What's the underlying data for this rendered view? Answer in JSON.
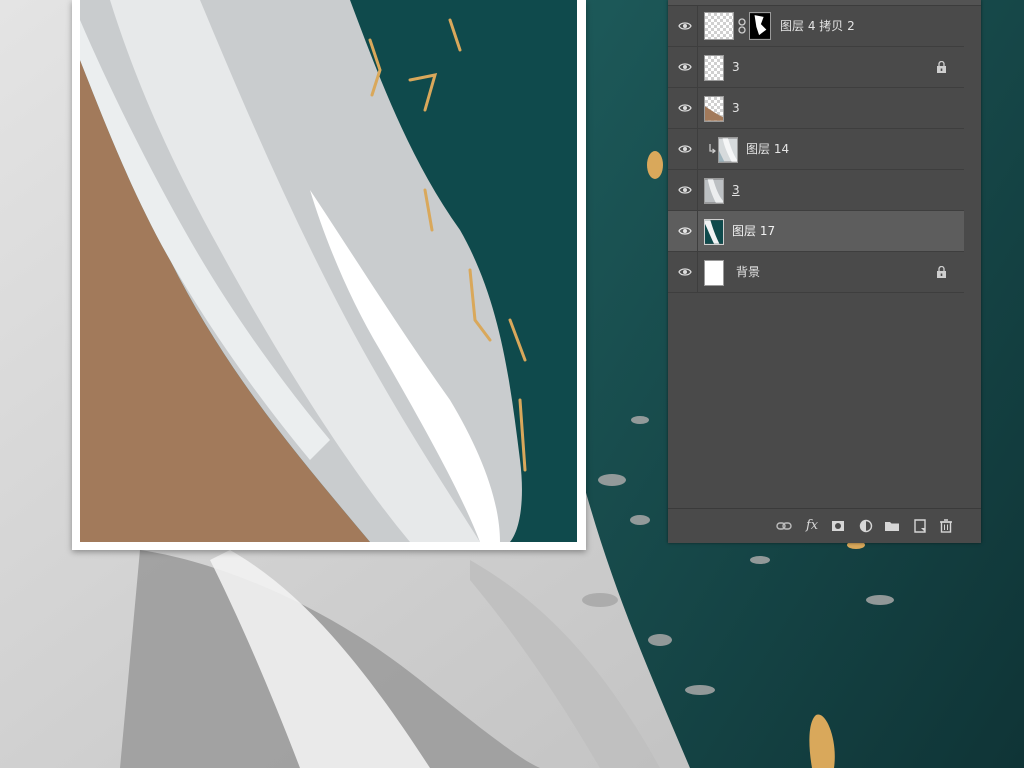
{
  "layers_panel": {
    "layers": [
      {
        "name": "图层 4 拷贝 2",
        "visible": true,
        "thumbnail": "checker-with-mask",
        "has_mask": true,
        "locked": false,
        "clipped": false,
        "selected": false
      },
      {
        "name": "3",
        "visible": true,
        "thumbnail": "checker",
        "locked": true,
        "clipped": false,
        "selected": false
      },
      {
        "name": "3",
        "visible": true,
        "thumbnail": "checker-brown",
        "locked": false,
        "clipped": false,
        "selected": false
      },
      {
        "name": "图层 14",
        "visible": true,
        "thumbnail": "gray-paint",
        "locked": false,
        "clipped": true,
        "selected": false
      },
      {
        "name": "3",
        "visible": true,
        "thumbnail": "gray-paint",
        "locked": false,
        "clipped": false,
        "selected": false
      },
      {
        "name": "图层 17",
        "visible": true,
        "thumbnail": "teal-paint",
        "locked": false,
        "clipped": false,
        "selected": true
      },
      {
        "name": "背景",
        "visible": true,
        "thumbnail": "white",
        "locked": true,
        "clipped": false,
        "selected": false
      }
    ],
    "footer_icons": [
      "link-layers-icon",
      "fx-icon",
      "add-mask-icon",
      "adjustment-layer-icon",
      "new-group-icon",
      "new-layer-icon",
      "delete-layer-icon"
    ],
    "fx_label": "fx"
  },
  "colors": {
    "panel_bg": "#4a4a4a",
    "selected_row": "#5d5d5d",
    "teal": "#0f4a4c",
    "sand": "#a27a5b",
    "gold": "#d9a85b"
  }
}
